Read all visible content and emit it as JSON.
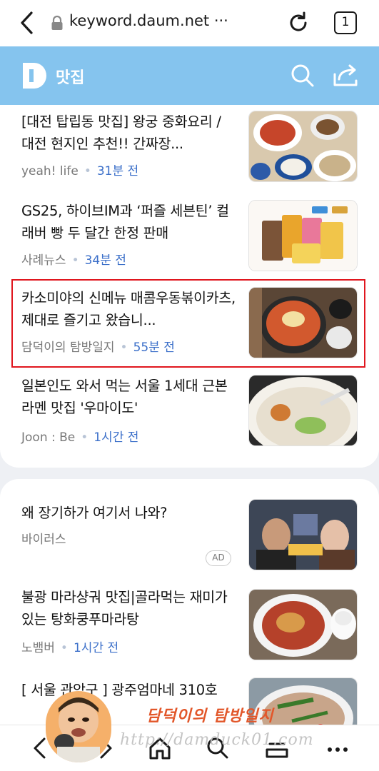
{
  "browser": {
    "url": "keyword.daum.net ···",
    "tab_count": "1"
  },
  "header": {
    "logo_letter": "D",
    "title": "맛집"
  },
  "feed": {
    "items": [
      {
        "title": "[대전 탑립동 맛집] 왕궁 중화요리 / 대전 현지인 추천!! 간짜장...",
        "source": "yeah! life",
        "time": "31분 전"
      },
      {
        "title": "GS25, 하이브IM과 ‘퍼즐 세븐틴’ 컬래버 빵 두 달간 한정 판매",
        "source": "사례뉴스",
        "time": "34분 전"
      },
      {
        "title": "카소미야의 신메뉴 매콤우동볶이카츠, 제대로 즐기고 왔습니...",
        "source": "담덕이의 탐방일지",
        "time": "55분 전"
      },
      {
        "title": "일본인도 와서 먹는 서울 1세대 근본 라멘 맛집 '우마이도'",
        "source": "Joon : Be",
        "time": "1시간 전"
      }
    ]
  },
  "feed2": {
    "items": [
      {
        "title": "왜 장기하가 여기서 나와?",
        "source": "바이러스",
        "badge": "AD"
      },
      {
        "title": "불광 마라샹궈 맛집|골라먹는 재미가 있는 탕화쿵푸마라탕",
        "source": "노뱀버",
        "time": "1시간 전"
      },
      {
        "title": "[ 서울 관악구 ] 광주엄마네 310호",
        "source": "",
        "time": ""
      }
    ]
  },
  "watermark": {
    "name": "담덕이의 탐방일지",
    "url": "http://damduck01.com"
  },
  "icons": {
    "back": "chevron-left-icon",
    "lock": "lock-icon",
    "refresh": "refresh-icon",
    "search": "search-icon",
    "share": "share-icon",
    "home": "home-icon",
    "bookmark": "bookmark-icon",
    "more": "more-icon"
  },
  "colors": {
    "header_bg": "#85c4ee",
    "time_blue": "#3b6fc9",
    "highlight_red": "#e0161e"
  }
}
